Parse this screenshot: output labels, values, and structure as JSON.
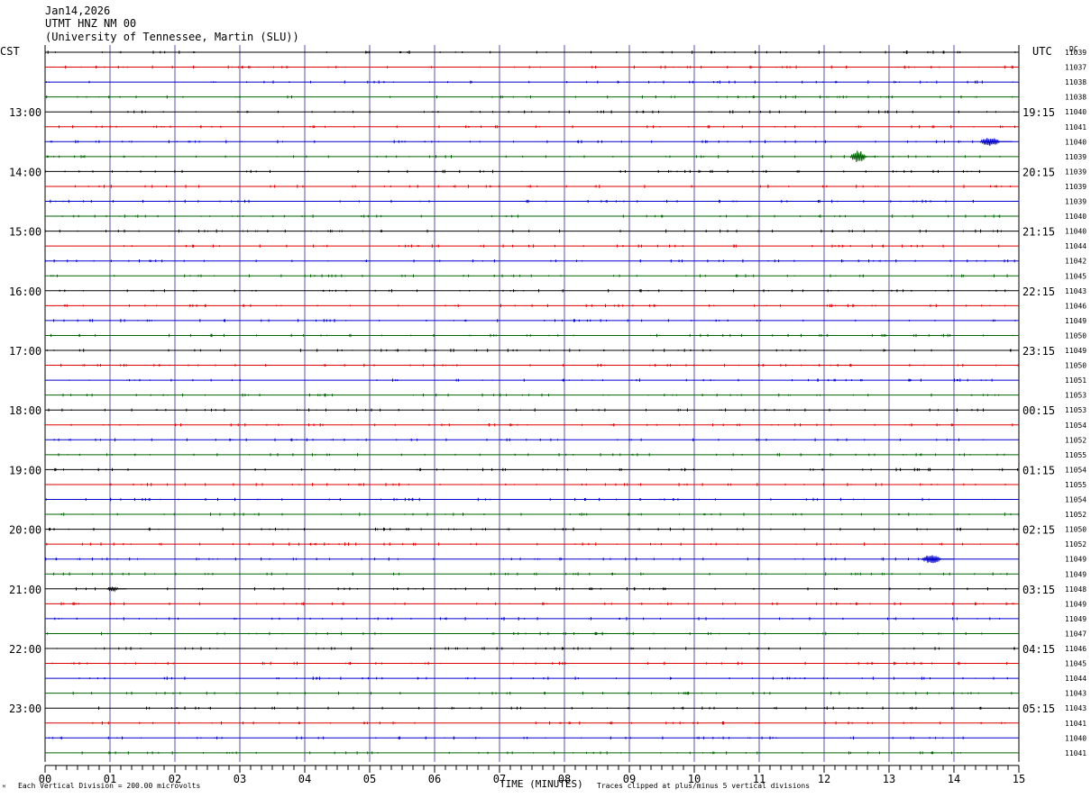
{
  "header": {
    "date": "Jan14,2026",
    "station": "UTMT HNZ NM 00",
    "network": "(University of Tennessee, Martin (SLU))"
  },
  "left_zone": "CST",
  "right_zone": "UTC",
  "dc_header": "DC",
  "footer": {
    "scale": "Each Vertical Division =  200.00 microvolts",
    "xlabel": "TIME (MINUTES)",
    "clip": "Traces clipped at plus/minus 5 vertical divisions",
    "corner_mark": "ᴹ"
  },
  "colors": {
    "trace_cycle": [
      "#000000",
      "#dd0000",
      "#0000cc",
      "#006600"
    ],
    "gridline": "#5555aa",
    "frame": "#000000"
  },
  "chart_data": {
    "type": "helicorder",
    "xlabel": "TIME (MINUTES)",
    "x_ticks": [
      "00",
      "01",
      "02",
      "03",
      "04",
      "05",
      "06",
      "07",
      "08",
      "09",
      "10",
      "11",
      "12",
      "13",
      "14",
      "15"
    ],
    "x_range": [
      0,
      15
    ],
    "minutes_per_line": 15,
    "left_hour_labels": [
      "13:00",
      "14:00",
      "15:00",
      "16:00",
      "17:00",
      "18:00",
      "19:00",
      "20:00",
      "21:00",
      "22:00",
      "23:00"
    ],
    "right_hour_labels": [
      "19:15",
      "20:15",
      "21:15",
      "22:15",
      "23:15",
      "00:15",
      "01:15",
      "02:15",
      "03:15",
      "04:15",
      "05:15"
    ],
    "dc_offsets": [
      11039,
      11037,
      11038,
      11038,
      11040,
      11041,
      11040,
      11039,
      11039,
      11039,
      11039,
      11040,
      11040,
      11044,
      11042,
      11045,
      11043,
      11046,
      11049,
      11050,
      11049,
      11050,
      11051,
      11053,
      11053,
      11054,
      11052,
      11055,
      11054,
      11055,
      11054,
      11052,
      11050,
      11052,
      11049,
      11049,
      11048,
      11049,
      11049,
      11047,
      11046,
      11045,
      11044,
      11043,
      11043,
      11041,
      11040,
      11041
    ],
    "events": [
      {
        "line": 6,
        "minute": 14.4,
        "amplitude": 6,
        "duration_min": 0.5
      },
      {
        "line": 7,
        "minute": 12.4,
        "amplitude": 9,
        "duration_min": 0.4
      },
      {
        "line": 34,
        "minute": 13.5,
        "amplitude": 6,
        "duration_min": 0.5
      },
      {
        "line": 36,
        "minute": 0.95,
        "amplitude": 3,
        "duration_min": 0.3
      }
    ]
  }
}
